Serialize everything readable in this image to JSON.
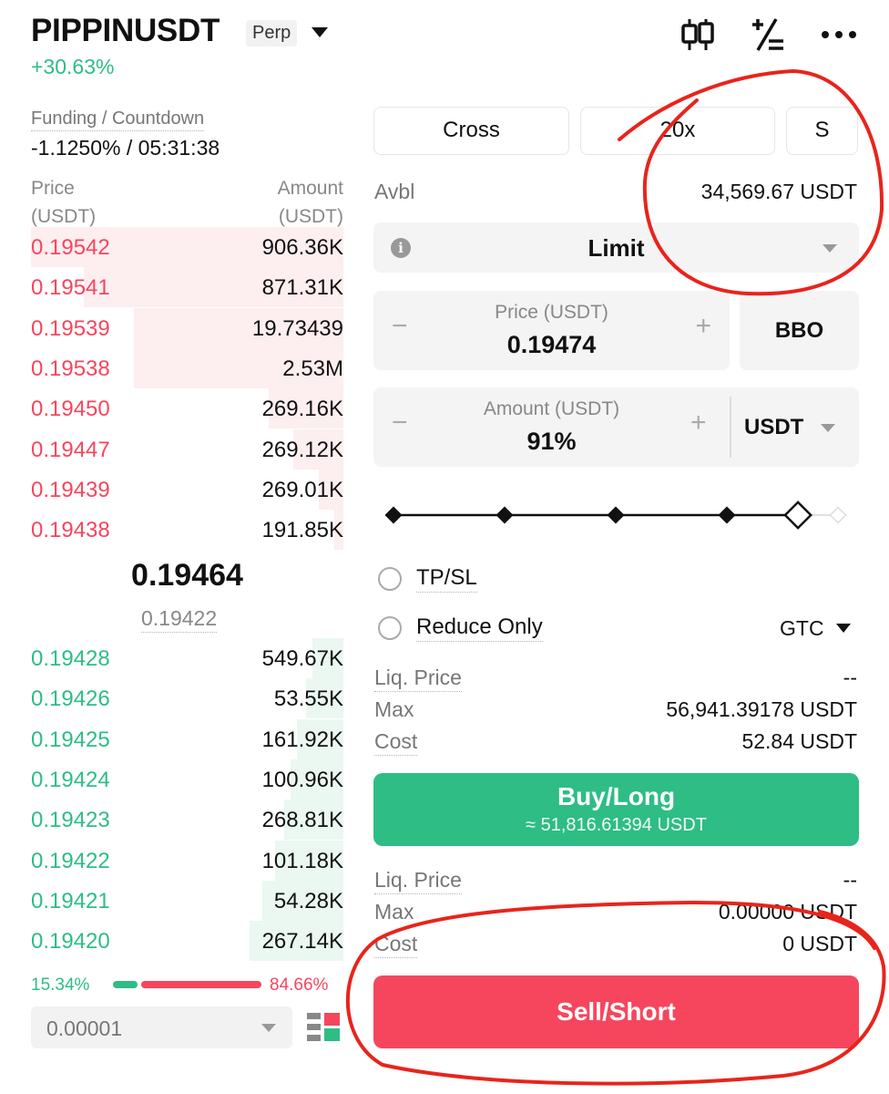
{
  "header": {
    "symbol": "PIPPINUSDT",
    "contract_type": "Perp",
    "change": "+30.63%",
    "icons": [
      "candlestick-icon",
      "plus-minus-icon",
      "more-icon"
    ]
  },
  "funding": {
    "label": "Funding / Countdown",
    "value": "-1.1250% / 05:31:38"
  },
  "orderbook": {
    "price_header": "Price",
    "price_unit": "(USDT)",
    "amount_header": "Amount",
    "amount_unit": "(USDT)",
    "asks": [
      {
        "price": "0.19542",
        "amount": "906.36K",
        "depth": 1.0
      },
      {
        "price": "0.19541",
        "amount": "871.31K",
        "depth": 0.83
      },
      {
        "price": "0.19539",
        "amount": "19.73439",
        "depth": 0.67
      },
      {
        "price": "0.19538",
        "amount": "2.53M",
        "depth": 0.67
      },
      {
        "price": "0.19450",
        "amount": "269.16K",
        "depth": 0.24
      },
      {
        "price": "0.19447",
        "amount": "269.12K",
        "depth": 0.16
      },
      {
        "price": "0.19439",
        "amount": "269.01K",
        "depth": 0.08
      },
      {
        "price": "0.19438",
        "amount": "191.85K",
        "depth": 0.03
      }
    ],
    "last_price": "0.19464",
    "mark_price": "0.19422",
    "bids": [
      {
        "price": "0.19428",
        "amount": "549.67K",
        "depth": 0.1
      },
      {
        "price": "0.19426",
        "amount": "53.55K",
        "depth": 0.12
      },
      {
        "price": "0.19425",
        "amount": "161.92K",
        "depth": 0.15
      },
      {
        "price": "0.19424",
        "amount": "100.96K",
        "depth": 0.17
      },
      {
        "price": "0.19423",
        "amount": "268.81K",
        "depth": 0.19
      },
      {
        "price": "0.19422",
        "amount": "101.18K",
        "depth": 0.22
      },
      {
        "price": "0.19421",
        "amount": "54.28K",
        "depth": 0.26
      },
      {
        "price": "0.19420",
        "amount": "267.14K",
        "depth": 0.3
      }
    ],
    "buy_ratio": "15.34%",
    "sell_ratio": "84.66%",
    "precision": "0.00001"
  },
  "order_form": {
    "margin_mode": "Cross",
    "leverage": "20x",
    "mode_short": "S",
    "avbl_label": "Avbl",
    "avbl_value": "34,569.67 USDT",
    "order_type": "Limit",
    "price_label": "Price (USDT)",
    "price_value": "0.19474",
    "bbo_label": "BBO",
    "amount_label": "Amount (USDT)",
    "amount_value": "91%",
    "amount_unit": "USDT",
    "slider_percent": 91,
    "tpsl_label": "TP/SL",
    "reduce_only_label": "Reduce Only",
    "time_in_force": "GTC",
    "buy": {
      "liq_label": "Liq. Price",
      "liq_value": "--",
      "max_label": "Max",
      "max_value": "56,941.39178 USDT",
      "cost_label": "Cost",
      "cost_value": "52.84 USDT",
      "button_label": "Buy/Long",
      "button_sub": "≈ 51,816.61394 USDT"
    },
    "sell": {
      "liq_label": "Liq. Price",
      "liq_value": "--",
      "max_label": "Max",
      "max_value": "0.00000 USDT",
      "cost_label": "Cost",
      "cost_value": "0 USDT",
      "button_label": "Sell/Short"
    }
  },
  "colors": {
    "buy": "#2ebd85",
    "sell": "#f6465d",
    "annotation": "#e8241c"
  }
}
